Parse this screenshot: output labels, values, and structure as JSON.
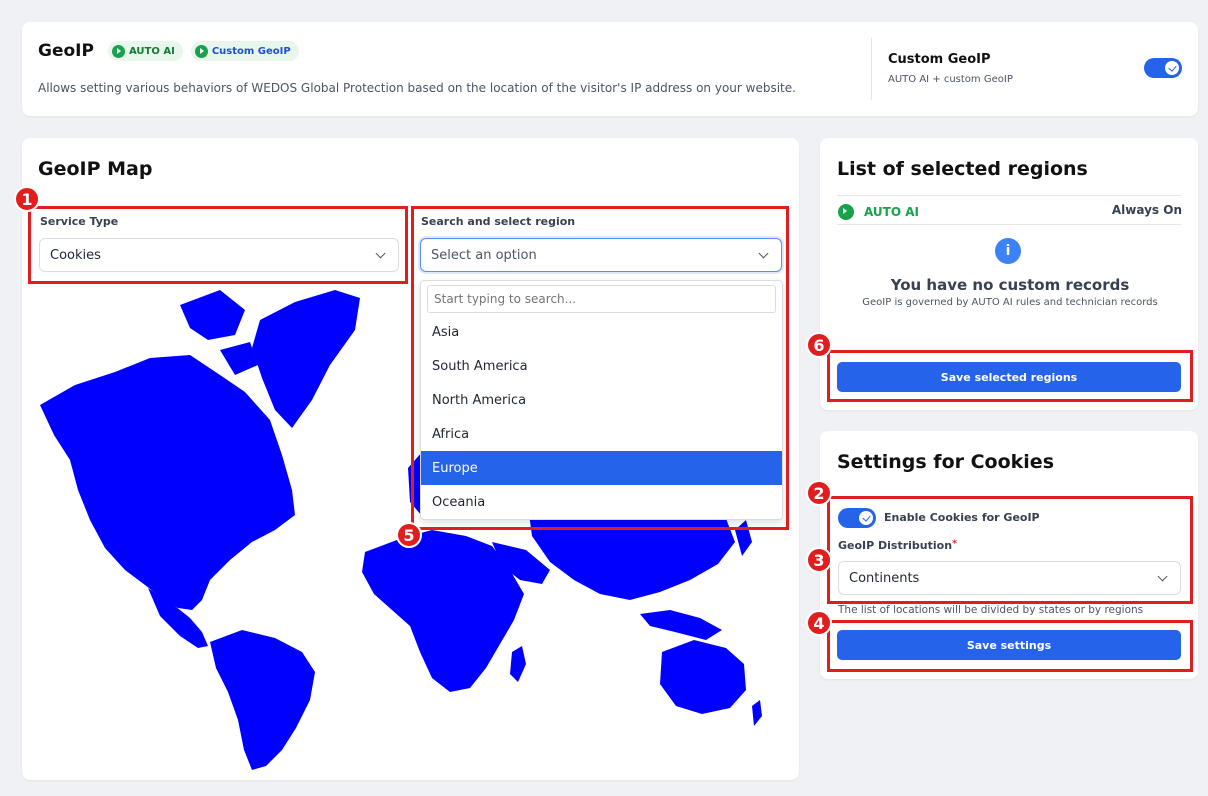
{
  "header": {
    "title": "GeoIP",
    "badge_auto_ai": "AUTO AI",
    "badge_custom": "Custom GeoIP",
    "description": "Allows setting various behaviors of WEDOS Global Protection based on the location of the visitor's IP address on your website.",
    "mode_title": "Custom GeoIP",
    "mode_subtitle": "AUTO AI + custom GeoIP",
    "mode_enabled": true
  },
  "map_panel": {
    "title": "GeoIP Map",
    "service_type_label": "Service Type",
    "service_type_value": "Cookies",
    "region_label": "Search and select region",
    "region_placeholder": "Select an option",
    "search_placeholder": "Start typing to search...",
    "region_options": [
      "Asia",
      "South America",
      "North America",
      "Africa",
      "Europe",
      "Oceania"
    ],
    "highlighted_option": "Europe"
  },
  "regions_panel": {
    "title": "List of selected regions",
    "auto_ai_label": "AUTO AI",
    "auto_ai_status": "Always On",
    "empty_title": "You have no custom records",
    "empty_subtitle": "GeoIP is governed by AUTO AI rules and technician records",
    "save_button": "Save selected regions"
  },
  "settings_panel": {
    "title": "Settings for Cookies",
    "enable_label": "Enable Cookies for GeoIP",
    "enable_on": true,
    "distribution_label": "GeoIP Distribution",
    "required_mark": "*",
    "distribution_value": "Continents",
    "hint": "The list of locations will be divided by states or by regions",
    "save_button": "Save settings"
  },
  "annotations": [
    "1",
    "2",
    "3",
    "4",
    "5",
    "6"
  ],
  "colors": {
    "accent": "#2563eb",
    "map_fill": "#0000ff",
    "annotation_red": "#e01e1e",
    "auto_ai_green": "#16a34a"
  }
}
